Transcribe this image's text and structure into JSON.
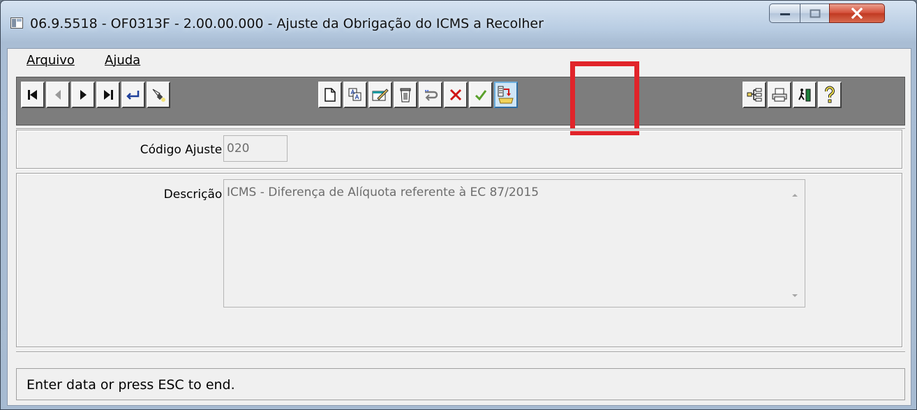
{
  "window": {
    "title": "06.9.5518 - OF0313F - 2.00.00.000 - Ajuste da Obrigação do ICMS a Recolher",
    "controls": [
      "minimize-icon",
      "maximize-icon",
      "close-icon"
    ]
  },
  "menu": {
    "items": [
      {
        "label": "Arquivo"
      },
      {
        "label": "Ajuda"
      }
    ]
  },
  "toolbar": {
    "navigation": [
      "first-record-icon",
      "previous-record-icon",
      "next-record-icon",
      "last-record-icon",
      "goto-icon",
      "search-icon"
    ],
    "edit": [
      "new-record-icon",
      "copy-record-icon",
      "modify-record-icon",
      "delete-record-icon",
      "undo-icon",
      "cancel-icon",
      "save-icon",
      "import-icon"
    ],
    "utility": [
      "tree-view-icon",
      "print-icon",
      "exit-icon",
      "help-icon"
    ],
    "highlighted_button": "import-icon",
    "highlight_color": "#e1242a"
  },
  "form": {
    "codigo_label": "Código Ajuste:",
    "codigo_value": "020",
    "descricao_label": "Descrição:",
    "descricao_value": "ICMS - Diferença de Alíquota referente à EC 87/2015"
  },
  "status": {
    "text": "Enter data or press ESC to end."
  }
}
